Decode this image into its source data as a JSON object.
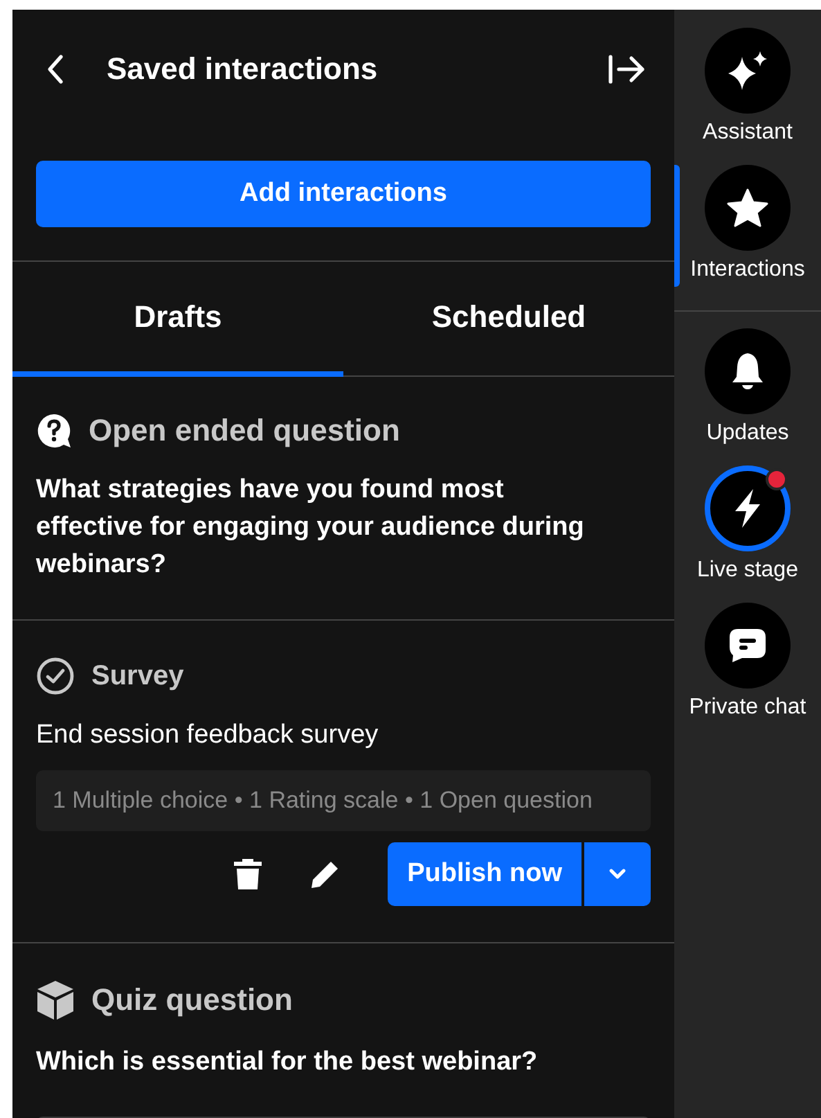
{
  "panel": {
    "title": "Saved interactions",
    "add_button": "Add interactions"
  },
  "tabs": [
    {
      "label": "Drafts",
      "selected": true
    },
    {
      "label": "Scheduled",
      "selected": false
    }
  ],
  "interactions": [
    {
      "kind": "open_ended",
      "type_label": "Open ended question",
      "question": "What strategies have you found most effective for engaging your audience during webinars?"
    },
    {
      "kind": "survey",
      "type_label": "Survey",
      "title": "End session feedback survey",
      "summary": "1 Multiple choice • 1 Rating scale • 1 Open question",
      "publish_button": "Publish now"
    },
    {
      "kind": "quiz",
      "type_label": "Quiz question",
      "question": "Which is essential for the best webinar?"
    }
  ],
  "rail": [
    {
      "kind": "assistant",
      "label": "Assistant",
      "selected": false,
      "live": false,
      "unread": false
    },
    {
      "kind": "interactions",
      "label": "Interactions",
      "selected": true,
      "live": false,
      "unread": false
    },
    {
      "kind": "updates",
      "label": "Updates",
      "selected": false,
      "live": false,
      "unread": false
    },
    {
      "kind": "live",
      "label": "Live stage",
      "selected": false,
      "live": true,
      "unread": true
    },
    {
      "kind": "chat",
      "label": "Private chat",
      "selected": false,
      "live": false,
      "unread": false
    }
  ]
}
